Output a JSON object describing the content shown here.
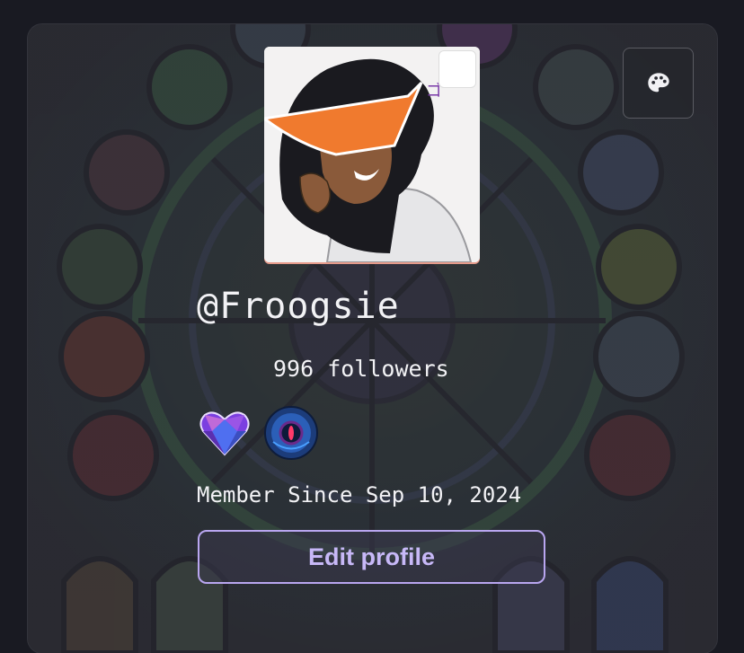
{
  "profile": {
    "username": "@Froogsie",
    "followers": "996 followers",
    "member_since": "Member Since Sep 10, 2024",
    "edit_label": "Edit profile"
  },
  "badges": [
    {
      "name": "purple-heart-gem-badge",
      "color": "#8a4fe0"
    },
    {
      "name": "blue-orb-eye-badge",
      "color": "#1f5fb8"
    }
  ],
  "colors": {
    "accent": "#c7b8f7",
    "accent_border": "#b9a6f0",
    "text": "#f2f2f5",
    "background": "#191a22"
  },
  "icons": {
    "theme": "palette-icon"
  }
}
